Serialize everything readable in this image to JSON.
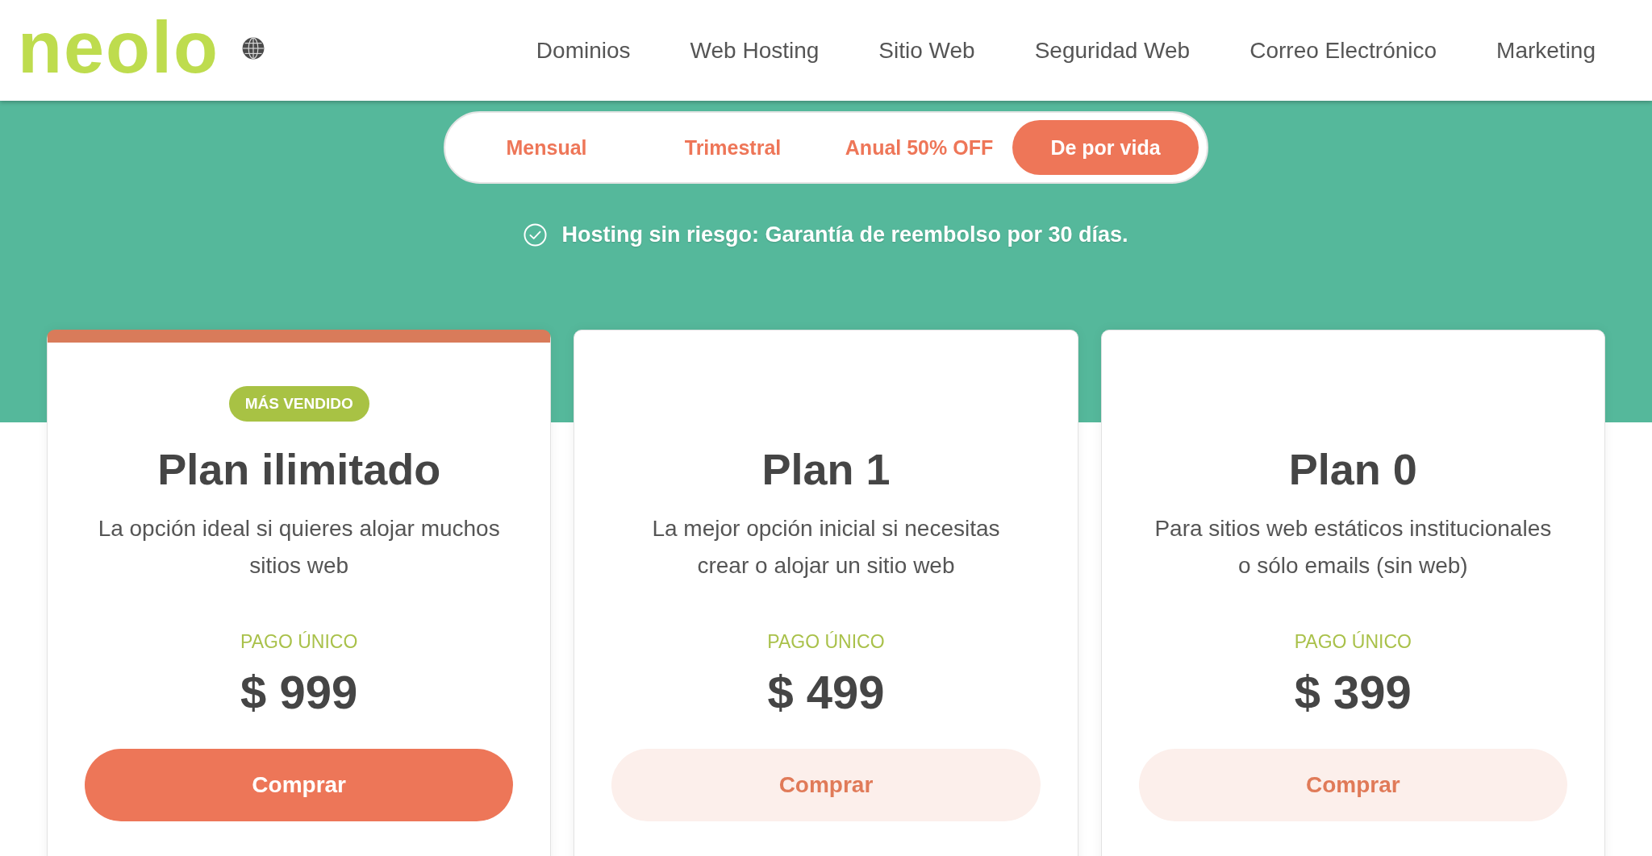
{
  "header": {
    "logo": "neolo",
    "nav": [
      "Dominios",
      "Web Hosting",
      "Sitio Web",
      "Seguridad Web",
      "Correo Electrónico",
      "Marketing"
    ]
  },
  "billing_toggle": [
    {
      "label": "Mensual",
      "selected": false
    },
    {
      "label": "Trimestral",
      "selected": false
    },
    {
      "label": "Anual 50% OFF",
      "selected": false
    },
    {
      "label": "De por vida",
      "selected": true
    }
  ],
  "guarantee": "Hosting sin riesgo: Garantía de reembolso por 30 días.",
  "plans": [
    {
      "featured": true,
      "badge": "MÁS VENDIDO",
      "name": "Plan ilimitado",
      "description": "La opción ideal si quieres alojar muchos sitios web",
      "price_label": "PAGO ÚNICO",
      "price": "$ 999",
      "button": "Comprar"
    },
    {
      "featured": false,
      "name": "Plan 1",
      "description": "La mejor opción inicial si necesitas crear o alojar un sitio web",
      "price_label": "PAGO ÚNICO",
      "price": "$ 499",
      "button": "Comprar"
    },
    {
      "featured": false,
      "name": "Plan 0",
      "description": "Para sitios web estáticos institucionales o sólo emails (sin web)",
      "price_label": "PAGO ÚNICO",
      "price": "$ 399",
      "button": "Comprar"
    }
  ]
}
